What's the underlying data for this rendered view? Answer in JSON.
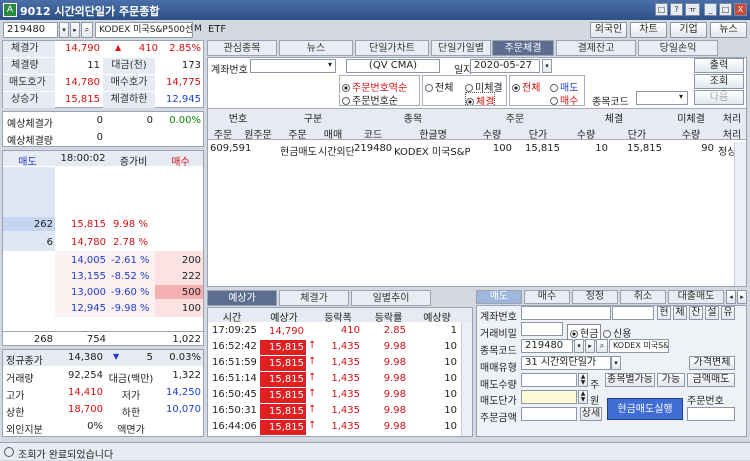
{
  "window": {
    "title": "9012 시간외단일가 주문종합",
    "logo": "A",
    "controls": [
      "□",
      "?",
      "ㅠ",
      "_",
      "□",
      "X"
    ]
  },
  "toolbar": {
    "code": "219480",
    "name": "KODEX 미국S&P500선기",
    "type": "ETF",
    "btns": [
      "외국인",
      "차트",
      "기업",
      "뉴스"
    ],
    "m": "M"
  },
  "quote": {
    "rows": [
      {
        "l": "체결가",
        "v": "14,790",
        "arrow": "▲",
        "chg": "410",
        "pct": "2.85%"
      },
      {
        "l": "체결량",
        "v": "11",
        "l2": "대금(천)",
        "v2": "173"
      },
      {
        "l": "매도호가",
        "v": "14,780",
        "l2": "매수호가",
        "v2": "14,775"
      },
      {
        "l": "상승가",
        "v": "15,815",
        "l2": "체결하한",
        "v2": "12,945"
      }
    ],
    "exp": [
      {
        "l": "예상체결가",
        "a": "0",
        "b": "0",
        "c": "0.00%"
      },
      {
        "l": "예상체결량",
        "a": "0"
      }
    ]
  },
  "book": {
    "hdr": [
      "매도",
      "18:00:02",
      "증가비",
      "매수"
    ],
    "asks": [
      {
        "q": "262",
        "p": "15,815",
        "r": "9.98 %"
      },
      {
        "q": "6",
        "p": "14,780",
        "r": "2.78 %"
      }
    ],
    "bids": [
      {
        "p": "14,005",
        "r": "-2.61 %",
        "q": "200"
      },
      {
        "p": "13,155",
        "r": "-8.52 %",
        "q": "222"
      },
      {
        "p": "13,000",
        "r": "-9.60 %",
        "q": "500"
      },
      {
        "p": "12,945",
        "r": "-9.98 %",
        "q": "100"
      }
    ],
    "tot": {
      "a": "268",
      "b": "754",
      "c": "1,022"
    }
  },
  "info": {
    "r1": {
      "l": "정규종가",
      "v": "14,380",
      "arr": "▼",
      "c": "5",
      "p": "0.03%"
    },
    "rows": [
      [
        "거래량",
        "92,254",
        "대금(백만)",
        "1,322"
      ],
      [
        "고가",
        "14,410",
        "저가",
        "14,250"
      ],
      [
        "상한",
        "18,700",
        "하한",
        "10,070"
      ],
      [
        "외인지분",
        "0%",
        "액면가",
        ""
      ]
    ]
  },
  "status": "조회가 완료되었습니다",
  "tabs": [
    "관심종목",
    "뉴스",
    "단일가차트",
    "단일가일별",
    "주문체결",
    "결제잔고",
    "당일손익"
  ],
  "order_query": {
    "acct_label": "계좌번호",
    "acct_name": "(QV CMA)",
    "date_label": "일자",
    "date": "2020-05-27",
    "sort": [
      "주문번호역순",
      "주문번호순"
    ],
    "fill": [
      "전체",
      "미체결",
      "체결"
    ],
    "side": [
      "전체",
      "매도",
      "매수"
    ],
    "code_label": "종목코드",
    "btns": [
      "출력",
      "조회",
      "다음"
    ]
  },
  "order_table": {
    "h1": [
      "번호",
      "구분",
      "종목",
      "주문",
      "체결",
      "미체결",
      "처리"
    ],
    "h2": [
      "주문",
      "원주문",
      "주문",
      "매매",
      "코드",
      "한글명",
      "수량",
      "단가",
      "수량",
      "단가",
      "수량",
      "처리"
    ],
    "row": [
      "609,591",
      "",
      "현금매도",
      "시간외단",
      "219480",
      "KODEX 미국S&P500",
      "100",
      "15,815",
      "10",
      "15,815",
      "90",
      "정상"
    ]
  },
  "ticks": {
    "tabs": [
      "예상가",
      "체결가",
      "일별추이"
    ],
    "hdr": [
      "시간",
      "예상가",
      "등락폭",
      "등락률",
      "예상량"
    ],
    "rows": [
      [
        "17:09:25",
        "14,790",
        "410",
        "2.85",
        "1"
      ],
      [
        "16:52:42",
        "15,815",
        "1,435",
        "9.98",
        "10"
      ],
      [
        "16:51:59",
        "15,815",
        "1,435",
        "9.98",
        "10"
      ],
      [
        "16:51:14",
        "15,815",
        "1,435",
        "9.98",
        "10"
      ],
      [
        "16:50:45",
        "15,815",
        "1,435",
        "9.98",
        "10"
      ],
      [
        "16:50:31",
        "15,815",
        "1,435",
        "9.98",
        "10"
      ],
      [
        "16:44:06",
        "15,815",
        "1,435",
        "9.98",
        "10"
      ]
    ]
  },
  "order_form": {
    "tabs": [
      "매도",
      "매수",
      "정정",
      "취소",
      "대출매도"
    ],
    "acct_label": "계좌번호",
    "pw_label": "거래비밀",
    "small_btns": [
      "현",
      "체",
      "잔",
      "설",
      "유"
    ],
    "cash": "현금",
    "credit": "신용",
    "code_label": "종목코드",
    "code": "219480",
    "name": "KODEX 미국S&P",
    "type_label": "매매유형",
    "type": "31 시간외단일가",
    "price_change": "가격변체",
    "qty_label": "매도수량",
    "qty_unit": "주",
    "btn_a": "종목별가능",
    "btn_b": "가능",
    "btn_c": "금액매도",
    "price_label": "매도단가",
    "price_unit": "원",
    "order_no_label": "주문번호",
    "amt_label": "주문금액",
    "amt_btn": "상세",
    "exec": "현금매도실행"
  }
}
